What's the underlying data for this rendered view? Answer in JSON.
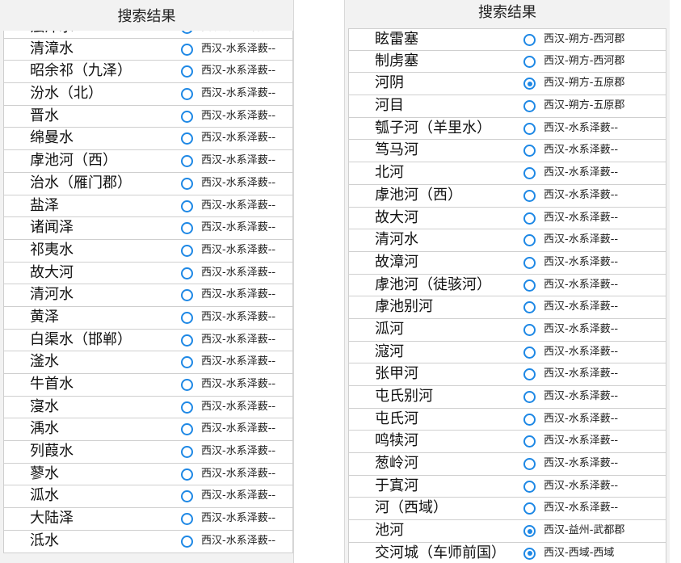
{
  "left": {
    "header": "搜索结果",
    "items": [
      {
        "name": "浊漳水",
        "sub": "西汉-水系泽薮--",
        "selected": false
      },
      {
        "name": "清漳水",
        "sub": "西汉-水系泽薮--",
        "selected": false
      },
      {
        "name": "昭余祁（九泽）",
        "sub": "西汉-水系泽薮--",
        "selected": false
      },
      {
        "name": "汾水（北）",
        "sub": "西汉-水系泽薮--",
        "selected": false
      },
      {
        "name": "晋水",
        "sub": "西汉-水系泽薮--",
        "selected": false
      },
      {
        "name": "绵曼水",
        "sub": "西汉-水系泽薮--",
        "selected": false
      },
      {
        "name": "虖池河（西）",
        "sub": "西汉-水系泽薮--",
        "selected": false
      },
      {
        "name": "治水（雁门郡）",
        "sub": "西汉-水系泽薮--",
        "selected": false
      },
      {
        "name": "盐泽",
        "sub": "西汉-水系泽薮--",
        "selected": false
      },
      {
        "name": "诸闻泽",
        "sub": "西汉-水系泽薮--",
        "selected": false
      },
      {
        "name": "祁夷水",
        "sub": "西汉-水系泽薮--",
        "selected": false
      },
      {
        "name": "故大河",
        "sub": "西汉-水系泽薮--",
        "selected": false
      },
      {
        "name": "清河水",
        "sub": "西汉-水系泽薮--",
        "selected": false
      },
      {
        "name": "黄泽",
        "sub": "西汉-水系泽薮--",
        "selected": false
      },
      {
        "name": "白渠水（邯郸）",
        "sub": "西汉-水系泽薮--",
        "selected": false
      },
      {
        "name": "滏水",
        "sub": "西汉-水系泽薮--",
        "selected": false
      },
      {
        "name": "牛首水",
        "sub": "西汉-水系泽薮--",
        "selected": false
      },
      {
        "name": "寖水",
        "sub": "西汉-水系泽薮--",
        "selected": false
      },
      {
        "name": "渪水",
        "sub": "西汉-水系泽薮--",
        "selected": false
      },
      {
        "name": "列葭水",
        "sub": "西汉-水系泽薮--",
        "selected": false
      },
      {
        "name": "蓼水",
        "sub": "西汉-水系泽薮--",
        "selected": false
      },
      {
        "name": "泒水",
        "sub": "西汉-水系泽薮--",
        "selected": false
      },
      {
        "name": "大陆泽",
        "sub": "西汉-水系泽薮--",
        "selected": false
      },
      {
        "name": "泜水",
        "sub": "西汉-水系泽薮--",
        "selected": false
      }
    ]
  },
  "right": {
    "header": "搜索结果",
    "items": [
      {
        "name": "眩雷塞",
        "sub": "西汉-朔方-西河郡",
        "selected": false
      },
      {
        "name": "制虏塞",
        "sub": "西汉-朔方-西河郡",
        "selected": false
      },
      {
        "name": "河阴",
        "sub": "西汉-朔方-五原郡",
        "selected": true
      },
      {
        "name": "河目",
        "sub": "西汉-朔方-五原郡",
        "selected": false
      },
      {
        "name": "瓠子河（羊里水）",
        "sub": "西汉-水系泽薮--",
        "selected": false
      },
      {
        "name": "笃马河",
        "sub": "西汉-水系泽薮--",
        "selected": false
      },
      {
        "name": "北河",
        "sub": "西汉-水系泽薮--",
        "selected": false
      },
      {
        "name": "虖池河（西）",
        "sub": "西汉-水系泽薮--",
        "selected": false
      },
      {
        "name": "故大河",
        "sub": "西汉-水系泽薮--",
        "selected": false
      },
      {
        "name": "清河水",
        "sub": "西汉-水系泽薮--",
        "selected": false
      },
      {
        "name": "故漳河",
        "sub": "西汉-水系泽薮--",
        "selected": false
      },
      {
        "name": "虖池河（徒骇河）",
        "sub": "西汉-水系泽薮--",
        "selected": false
      },
      {
        "name": "虖池别河",
        "sub": "西汉-水系泽薮--",
        "selected": false
      },
      {
        "name": "泒河",
        "sub": "西汉-水系泽薮--",
        "selected": false
      },
      {
        "name": "滱河",
        "sub": "西汉-水系泽薮--",
        "selected": false
      },
      {
        "name": "张甲河",
        "sub": "西汉-水系泽薮--",
        "selected": false
      },
      {
        "name": "屯氏别河",
        "sub": "西汉-水系泽薮--",
        "selected": false
      },
      {
        "name": "屯氏河",
        "sub": "西汉-水系泽薮--",
        "selected": false
      },
      {
        "name": "鸣犊河",
        "sub": "西汉-水系泽薮--",
        "selected": false
      },
      {
        "name": "葱岭河",
        "sub": "西汉-水系泽薮--",
        "selected": false
      },
      {
        "name": "于寘河",
        "sub": "西汉-水系泽薮--",
        "selected": false
      },
      {
        "name": "河（西域）",
        "sub": "西汉-水系泽薮--",
        "selected": false
      },
      {
        "name": "池河",
        "sub": "西汉-益州-武都郡",
        "selected": true
      },
      {
        "name": "交河城（车师前国）",
        "sub": "西汉-西域-西域",
        "selected": true
      }
    ]
  }
}
